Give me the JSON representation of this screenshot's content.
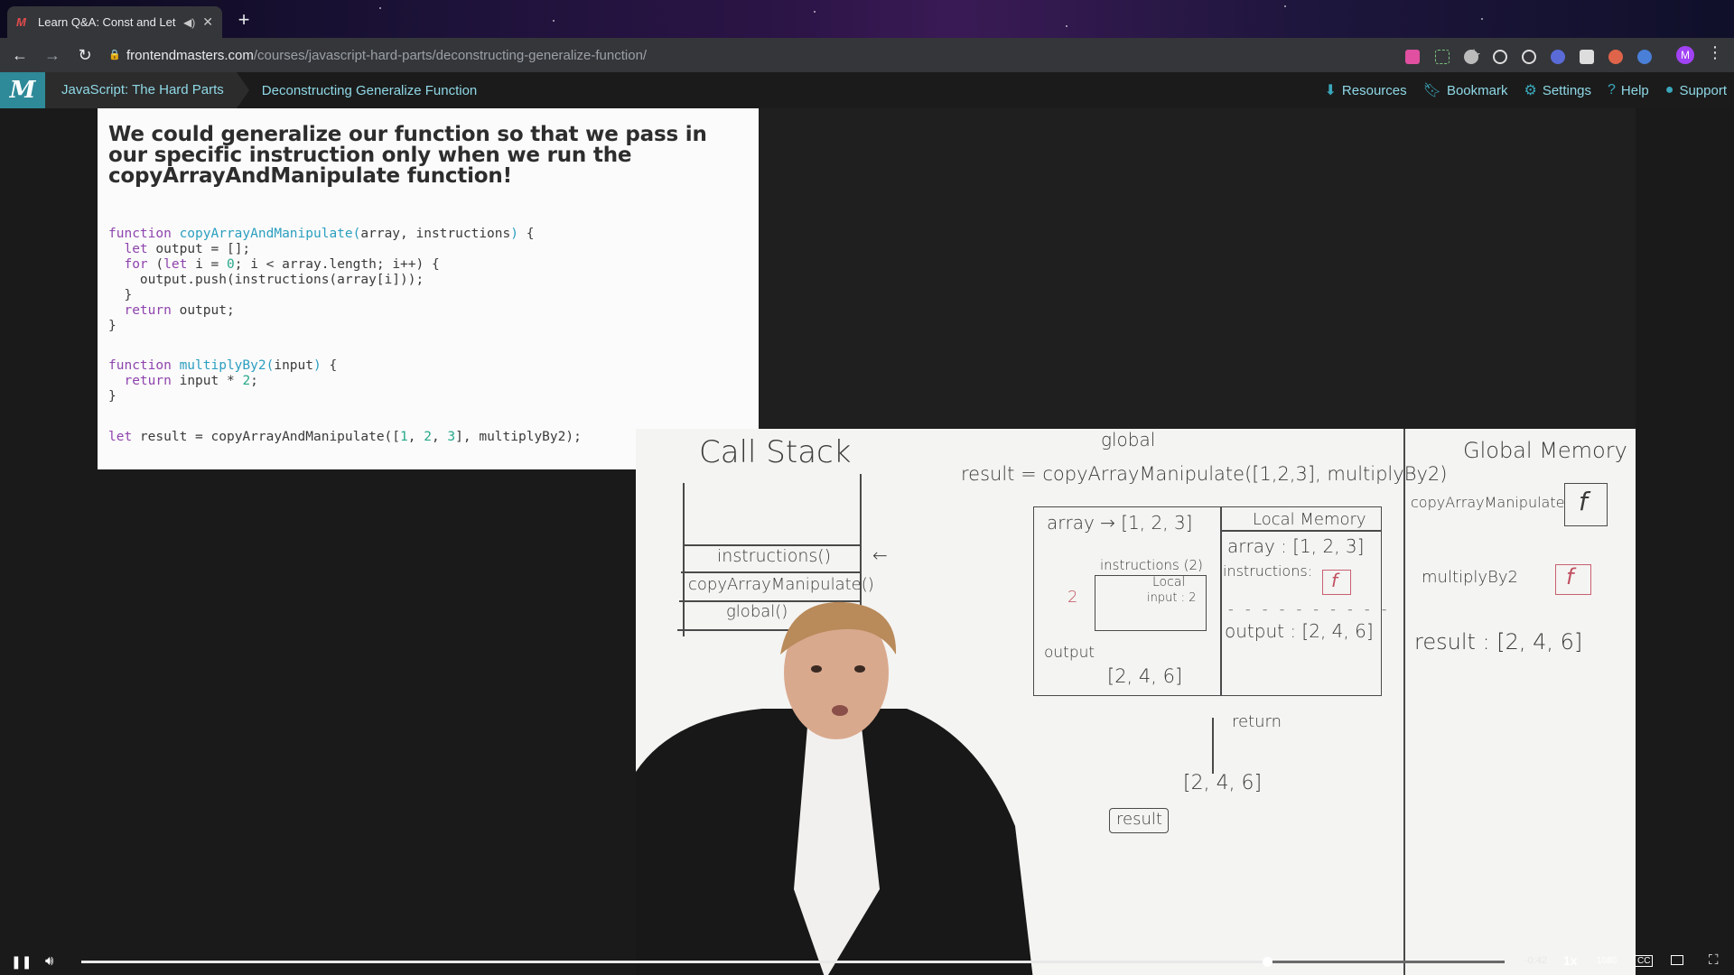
{
  "browser": {
    "tab_title": "Learn Q&A: Const and Let",
    "url_host": "frontendmasters.com",
    "url_path": "/courses/javascript-hard-parts/deconstructing-generalize-function/",
    "profile_initial": "M"
  },
  "site": {
    "course": "JavaScript: The Hard Parts",
    "lesson": "Deconstructing Generalize Function",
    "nav": [
      {
        "label": "Resources",
        "icon": "download-icon"
      },
      {
        "label": "Bookmark",
        "icon": "bookmark-icon"
      },
      {
        "label": "Settings",
        "icon": "gear-icon"
      },
      {
        "label": "Help",
        "icon": "help-icon"
      },
      {
        "label": "Support",
        "icon": "chat-icon"
      }
    ]
  },
  "slide": {
    "heading": "We could generalize our function so that we pass in our specific instruction only when we run the copyArrayAndManipulate function!"
  },
  "whiteboard": {
    "call_stack_title": "Call Stack",
    "stack_frames": [
      "instructions()",
      "copyArrayManipulate()",
      "global()"
    ],
    "global_label": "global",
    "result_expr": "result  =  copyArrayManipulate([1,2,3], multiplyBy2)",
    "array_label": "array → [1, 2, 3]",
    "local_memory_title": "Local Memory",
    "local_array": "array : [1, 2, 3]",
    "local_instructions": "instructions:",
    "local_output": "output : [2, 4, 6]",
    "inner_call": "instructions (2)",
    "inner_local": "Local",
    "inner_input": "input : 2",
    "output_label": "output",
    "output_array": "[2, 4, 6]",
    "return_label": "return",
    "returned_array": "[2, 4, 6]",
    "result_box": "result",
    "global_memory_title": "Global Memory",
    "gm_copy": "copyArrayManipulate",
    "gm_multiply": "multiplyBy2",
    "gm_result": "result : [2, 4, 6]",
    "fn_symbol": "f"
  },
  "player": {
    "time_remaining": "-0:42",
    "rate": "1x",
    "quality": "1080",
    "progress": 0.833
  }
}
